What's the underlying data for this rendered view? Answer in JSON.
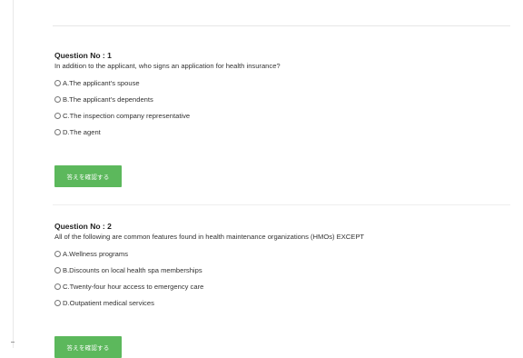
{
  "questions": [
    {
      "number": "Question No : 1",
      "text": "In addition to the applicant, who signs an application for health insurance?",
      "options": [
        "A.The applicant's spouse",
        "B.The applicant's dependents",
        "C.The inspection company representative",
        "D.The agent"
      ],
      "button_label": "答えを確認する"
    },
    {
      "number": "Question No : 2",
      "text": "All of the following are common features found in health maintenance organizations (HMOs) EXCEPT",
      "options": [
        "A.Wellness programs",
        "B.Discounts on local health spa memberships",
        "C.Twenty-four hour access to emergency care",
        "D.Outpatient medical services"
      ],
      "button_label": "答えを確認する"
    }
  ],
  "colors": {
    "button_green": "#5cb85c",
    "text": "#333333",
    "divider": "#e6e6e6"
  }
}
